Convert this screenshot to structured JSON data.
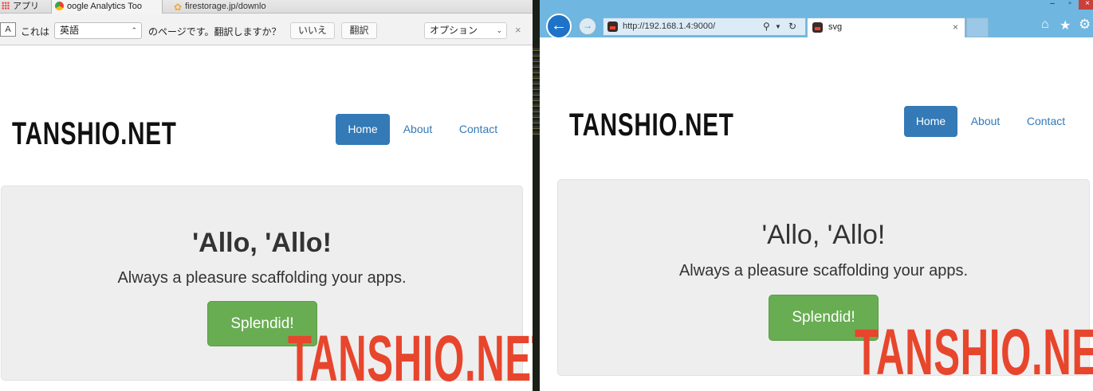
{
  "left_browser": {
    "tabs": [
      {
        "label": "アプリ"
      },
      {
        "label": "oogle Analytics Too"
      },
      {
        "label": "firestorage.jp/downlo"
      }
    ],
    "translate_bar": {
      "intro": "これは",
      "language": "英語",
      "question": "のページです。翻訳しますか？",
      "no_label": "いいえ",
      "translate_label": "翻訳",
      "options_label": "オプション",
      "close": "×"
    }
  },
  "right_browser": {
    "url": "http://192.168.1.4:9000/",
    "tab_title": "svg",
    "tab_close": "×"
  },
  "site": {
    "brand": "TANSHIO.NET",
    "nav": [
      {
        "label": "Home"
      },
      {
        "label": "About"
      },
      {
        "label": "Contact"
      }
    ],
    "jumbotron": {
      "title": "'Allo, 'Allo!",
      "subtitle": "Always a pleasure scaffolding your apps.",
      "button": "Splendid!"
    }
  },
  "watermark": "TANSHIO.NET",
  "colors": {
    "primary": "#337ab7",
    "success": "#68ad52",
    "jumbotron_bg": "#eeeeee",
    "watermark": "#e8452d",
    "ie_frame": "#6fb6e0"
  },
  "icons": {
    "back": "back-arrow-icon",
    "forward": "forward-arrow-icon",
    "search": "search-icon",
    "refresh": "refresh-icon",
    "home": "home-icon",
    "favorites": "star-icon",
    "settings": "gear-icon"
  }
}
